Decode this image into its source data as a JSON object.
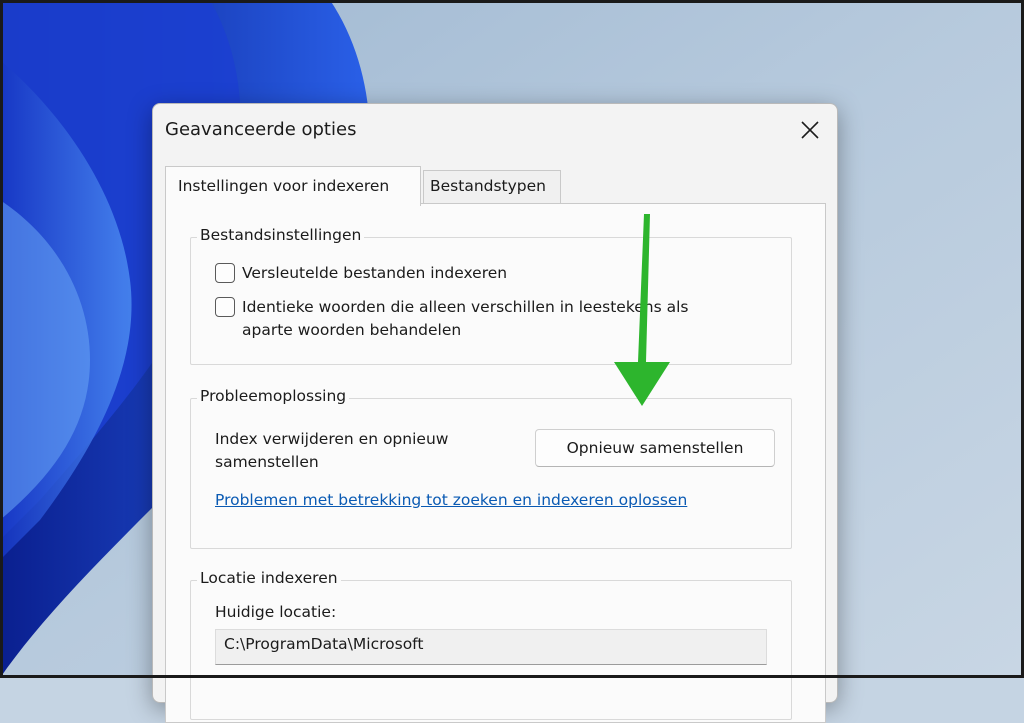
{
  "dialog": {
    "title": "Geavanceerde opties",
    "close_icon": "close-icon"
  },
  "tabs": [
    {
      "label": "Instellingen voor indexeren",
      "active": true
    },
    {
      "label": "Bestandstypen",
      "active": false
    }
  ],
  "file_settings": {
    "legend": "Bestandsinstellingen",
    "options": [
      {
        "label": "Versleutelde bestanden indexeren",
        "checked": false
      },
      {
        "label": "Identieke woorden die alleen verschillen in leestekens als aparte woorden behandelen",
        "checked": false
      }
    ]
  },
  "troubleshooting": {
    "legend": "Probleemoplossing",
    "description": "Index verwijderen en opnieuw samenstellen",
    "rebuild_button": "Opnieuw samenstellen",
    "link": "Problemen met betrekking tot zoeken en indexeren oplossen"
  },
  "index_location": {
    "legend": "Locatie indexeren",
    "current_label": "Huidige locatie:",
    "current_value": "C:\\ProgramData\\Microsoft"
  },
  "colors": {
    "annotation_arrow": "#2db52d",
    "link": "#0a5ab3",
    "accent_wallpaper": "#1f4fd6"
  }
}
